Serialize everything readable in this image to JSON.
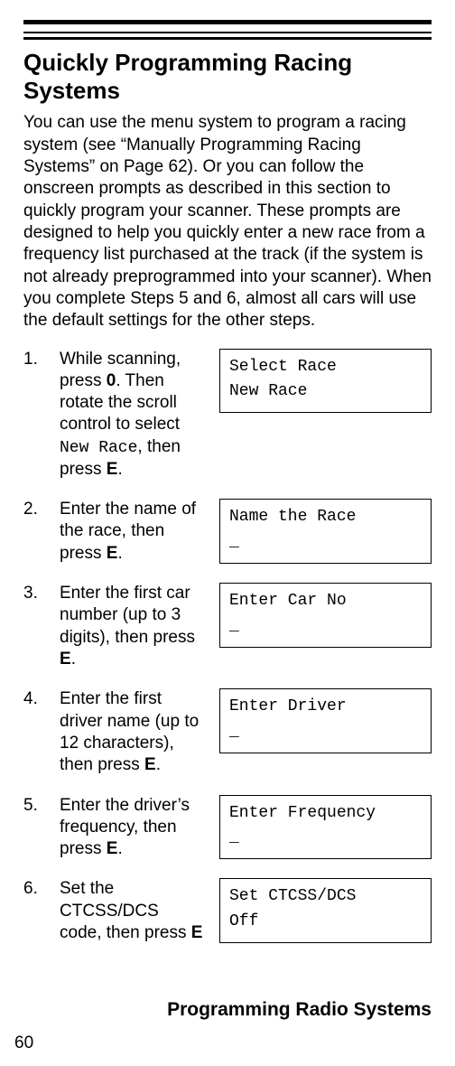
{
  "heading": "Quickly Programming Racing Systems",
  "intro": "You can use the menu system to program a racing system (see “Manually Programming Racing Systems” on Page 62). Or you can follow the onscreen prompts as described in this section to quickly program your scanner. These prompts are designed to help you quickly enter a new race from a frequency list purchased at the track (if the system is not already preprogrammed into your scanner). When you complete Steps 5 and 6, almost all cars will use the default settings for the other steps.",
  "steps": [
    {
      "num": "1.",
      "text_pre": "While scanning, press ",
      "bold1": "0",
      "text_mid1": ". Then rotate the scroll control to select ",
      "mono": "New Race",
      "text_mid2": ", then press ",
      "bold2": "E",
      "text_post": ".",
      "lcd_line1": "Select Race",
      "lcd_line2": "New Race"
    },
    {
      "num": "2.",
      "text_pre": "Enter the name of the race, then press ",
      "bold1": "E",
      "text_mid1": ".",
      "mono": "",
      "text_mid2": "",
      "bold2": "",
      "text_post": "",
      "lcd_line1": "Name the Race",
      "lcd_line2": "_"
    },
    {
      "num": "3.",
      "text_pre": "Enter the first car number (up to 3 digits), then press ",
      "bold1": "E",
      "text_mid1": ".",
      "mono": "",
      "text_mid2": "",
      "bold2": "",
      "text_post": "",
      "lcd_line1": "Enter Car No",
      "lcd_line2": "_"
    },
    {
      "num": "4.",
      "text_pre": "Enter the first driver name (up to 12 characters), then press ",
      "bold1": "E",
      "text_mid1": ".",
      "mono": "",
      "text_mid2": "",
      "bold2": "",
      "text_post": "",
      "lcd_line1": "Enter Driver",
      "lcd_line2": "_"
    },
    {
      "num": "5.",
      "text_pre": "Enter the driver’s frequency, then press ",
      "bold1": "E",
      "text_mid1": ".",
      "mono": "",
      "text_mid2": "",
      "bold2": "",
      "text_post": "",
      "lcd_line1": "Enter Frequency",
      "lcd_line2": "_"
    },
    {
      "num": "6.",
      "text_pre": "Set the CTCSS/DCS code, then press ",
      "bold1": "E",
      "text_mid1": "",
      "mono": "",
      "text_mid2": "",
      "bold2": "",
      "text_post": "",
      "lcd_line1": "Set CTCSS/DCS",
      "lcd_line2": "Off"
    }
  ],
  "footer_title": "Programming Radio Systems",
  "page_number": "60"
}
